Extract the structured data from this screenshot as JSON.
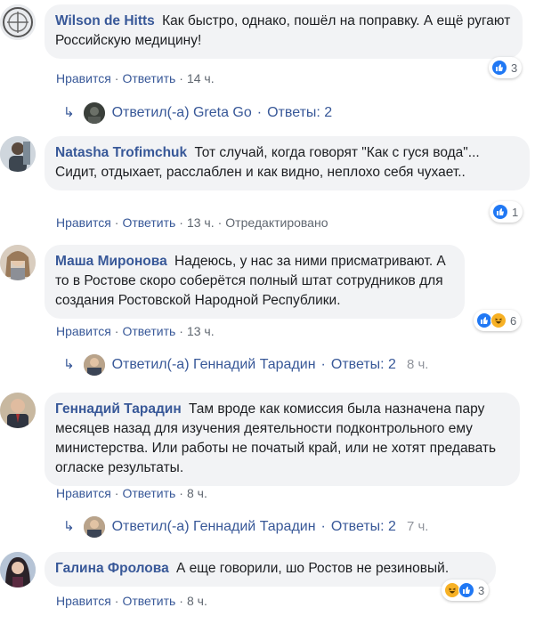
{
  "actions": {
    "like": "Нравится",
    "reply": "Ответить",
    "sep": "·"
  },
  "comments": [
    {
      "author": "Wilson de Hitts",
      "text": "Как быстро, однако, пошёл на поправку. А ещё ругают Российскую медицину!",
      "time": "14 ч.",
      "edited": "",
      "reactions": {
        "icons": [
          "like-icon"
        ],
        "count": "3"
      },
      "reply": {
        "label": "Ответил(-а) Greta Go",
        "replies": "Ответы: 2",
        "time": ""
      }
    },
    {
      "author": "Natasha Trofimchuk",
      "text": "Тот случай, когда говорят \"Как с гуся вода\"... Сидит, отдыхает, расслаблен и как видно, неплохо себя чухает..",
      "time": "13 ч.",
      "edited": "Отредактировано",
      "reactions": {
        "icons": [
          "like-icon"
        ],
        "count": "1"
      },
      "reply": null
    },
    {
      "author": "Маша Миронова",
      "text": "Надеюсь, у нас за ними присматривают. А то в Ростове скоро соберётся полный штат сотрудников для создания Ростовской Народной Республики.",
      "time": "13 ч.",
      "edited": "",
      "reactions": {
        "icons": [
          "like-icon",
          "haha-icon"
        ],
        "count": "6"
      },
      "reply": {
        "label": "Ответил(-а) Геннадий Тарадин",
        "replies": "Ответы: 2",
        "time": "8 ч."
      }
    },
    {
      "author": "Геннадий Тарадин",
      "text": "Там вроде как комиссия была назначена пару месяцев назад для изучения деятельности подконтрольного ему министерства. Или работы не початый край, или не хотят предавать огласке результаты.",
      "time": "8 ч.",
      "edited": "",
      "reactions": null,
      "reply": {
        "label": "Ответил(-а) Геннадий Тарадин",
        "replies": "Ответы: 2",
        "time": "7 ч."
      }
    },
    {
      "author": "Галина Фролова",
      "text": "А еще говорили, шо Ростов не резиновый.",
      "time": "8 ч.",
      "edited": "",
      "reactions": {
        "icons": [
          "haha-icon",
          "like-icon"
        ],
        "count": "3"
      },
      "reply": null
    }
  ],
  "colors": {
    "link": "#385898",
    "bubble": "#f2f3f5",
    "meta": "#606770",
    "like": "#2078f4",
    "haha": "#f7b125"
  }
}
